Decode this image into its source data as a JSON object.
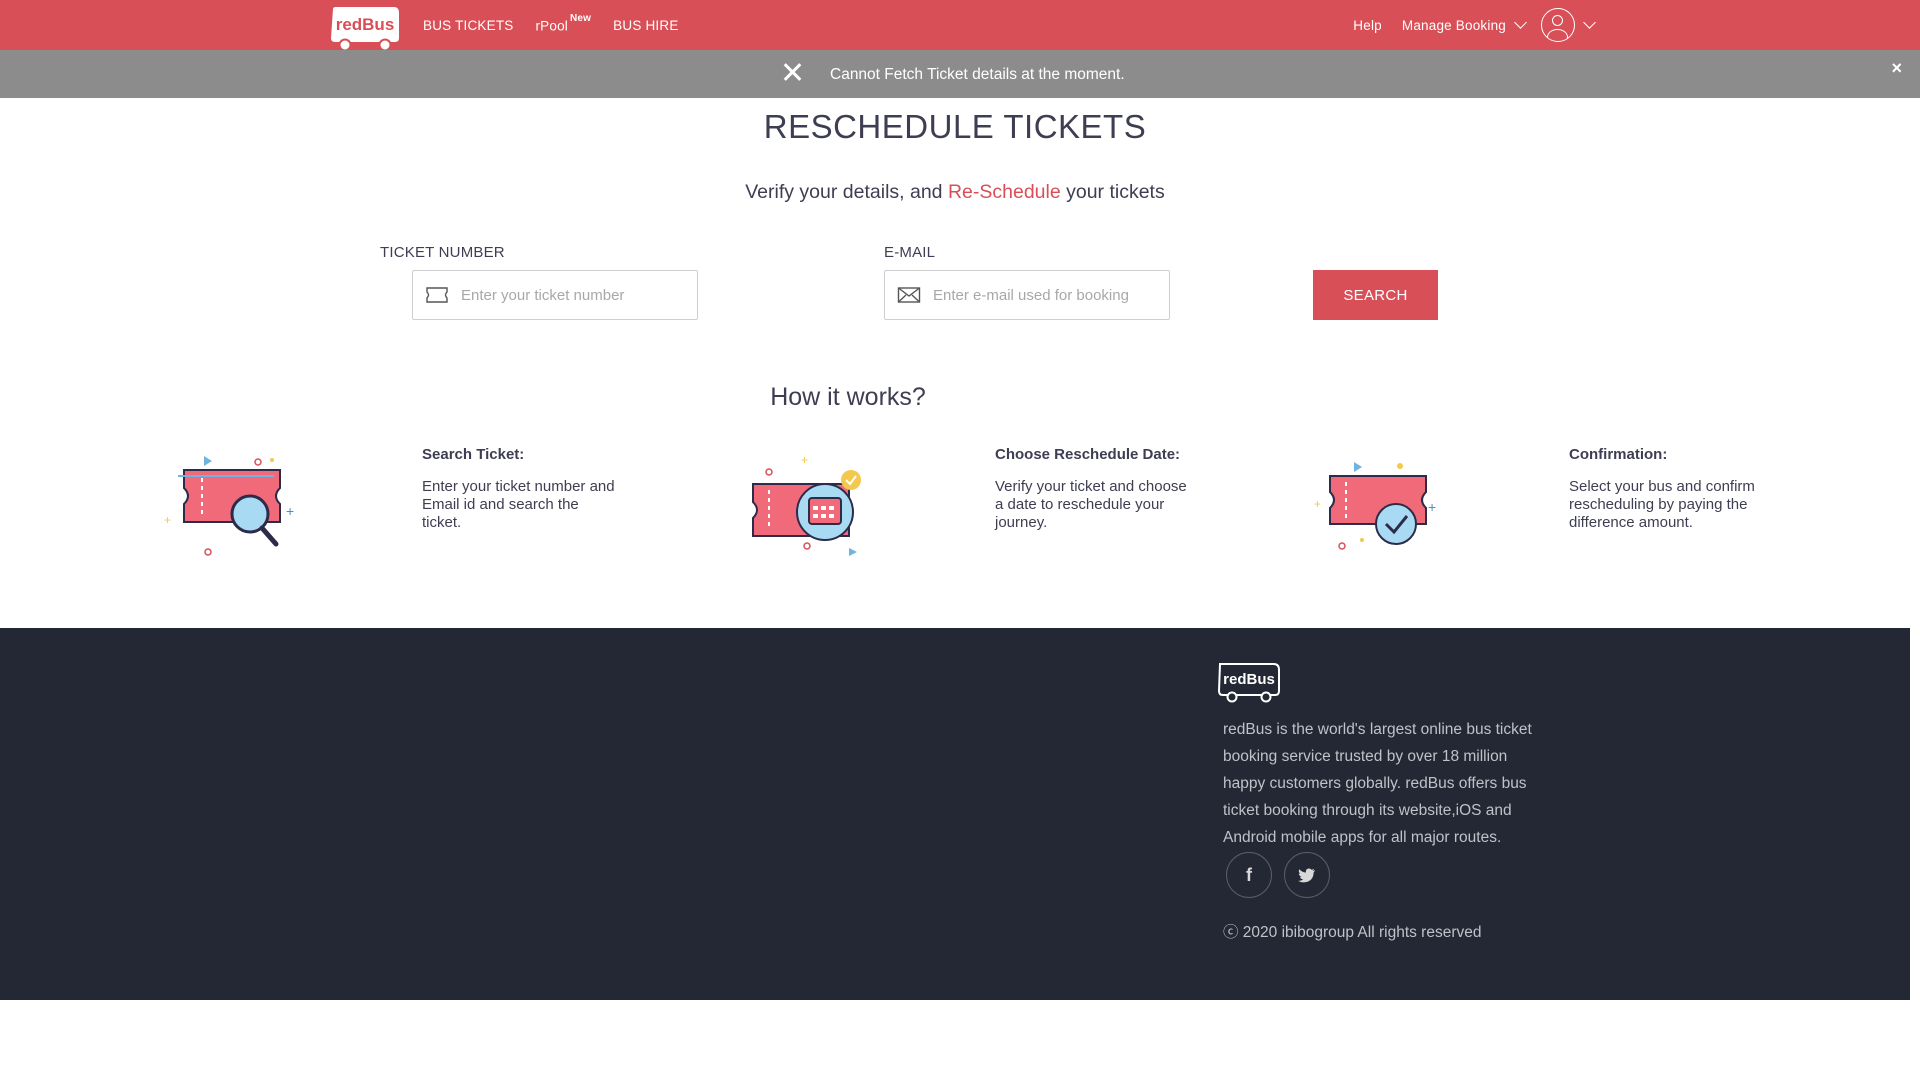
{
  "header": {
    "logo_text": "redBus",
    "nav_left": [
      {
        "label": "BUS TICKETS"
      },
      {
        "label": "rPool",
        "badge": "New"
      },
      {
        "label": "BUS HIRE"
      }
    ],
    "help_label": "Help",
    "manage_booking_label": "Manage Booking",
    "brand_color": "#d84f57"
  },
  "alert": {
    "message": "Cannot Fetch Ticket details at the moment.",
    "close_label": "×"
  },
  "main": {
    "title": "RESCHEDULE TICKETS",
    "subtitle_prefix": "Verify your details, and ",
    "subtitle_highlight": "Re-Schedule",
    "subtitle_suffix": " your tickets",
    "ticket_label": "TICKET NUMBER",
    "ticket_placeholder": "Enter your ticket number",
    "email_label": "E-MAIL",
    "email_placeholder": "Enter e-mail used for booking",
    "search_label": "SEARCH",
    "how_title": "How it works?",
    "steps": [
      {
        "title": "Search Ticket:",
        "desc": "Enter your ticket number and Email id and search the ticket.",
        "icon": "ticket-search-icon"
      },
      {
        "title": "Choose Reschedule Date:",
        "desc": "Verify your ticket and choose a date to reschedule your journey.",
        "icon": "ticket-calendar-icon"
      },
      {
        "title": "Confirmation:",
        "desc": "Select your bus and confirm rescheduling by paying the difference amount.",
        "icon": "ticket-check-icon"
      }
    ]
  },
  "footer": {
    "logo_text": "redBus",
    "about": "redBus is the world's largest online bus ticket booking service trusted by over 18 million happy customers globally. redBus offers bus ticket booking through its website,iOS and Android mobile apps for all major routes.",
    "social": [
      {
        "name": "facebook-icon",
        "glyph": "f"
      },
      {
        "name": "twitter-icon",
        "glyph": "🐦"
      }
    ],
    "copyright": "ⓒ 2020 ibibogroup All rights reserved",
    "bg_color": "#242834"
  }
}
